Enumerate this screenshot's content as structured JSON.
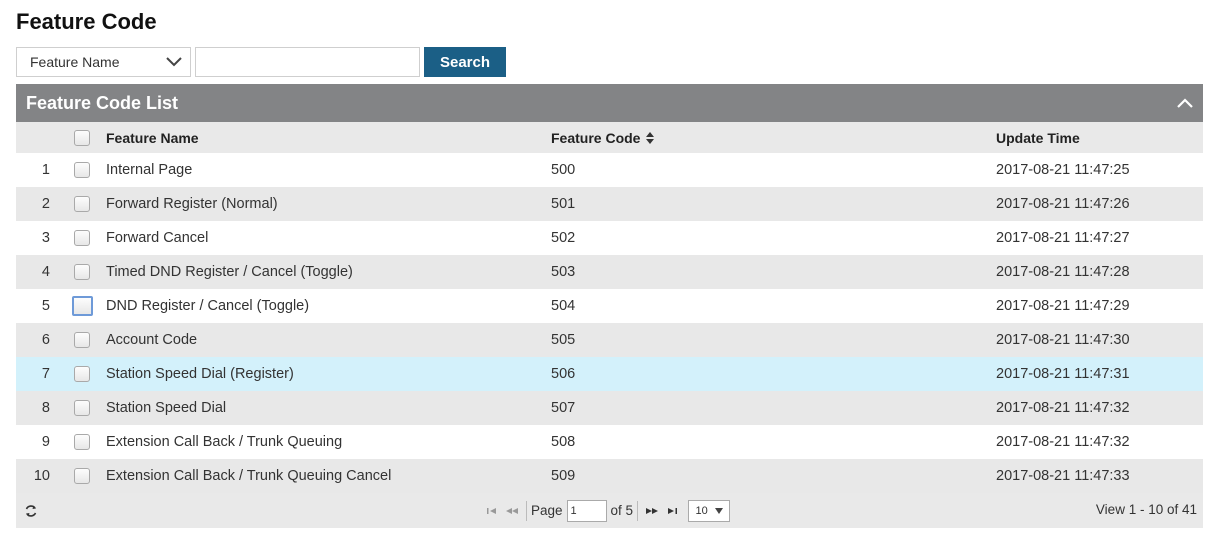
{
  "page": {
    "title": "Feature Code"
  },
  "search": {
    "field_select": "Feature Name",
    "input_value": "",
    "button_label": "Search"
  },
  "panel": {
    "title": "Feature Code List",
    "columns": {
      "name": "Feature Name",
      "code": "Feature Code",
      "time": "Update Time"
    }
  },
  "rows": [
    {
      "num": "1",
      "name": "Internal Page",
      "code": "500",
      "time": "2017-08-21 11:47:25"
    },
    {
      "num": "2",
      "name": "Forward Register (Normal)",
      "code": "501",
      "time": "2017-08-21 11:47:26"
    },
    {
      "num": "3",
      "name": "Forward Cancel",
      "code": "502",
      "time": "2017-08-21 11:47:27"
    },
    {
      "num": "4",
      "name": "Timed DND Register / Cancel (Toggle)",
      "code": "503",
      "time": "2017-08-21 11:47:28"
    },
    {
      "num": "5",
      "name": "DND Register / Cancel (Toggle)",
      "code": "504",
      "time": "2017-08-21 11:47:29"
    },
    {
      "num": "6",
      "name": "Account Code",
      "code": "505",
      "time": "2017-08-21 11:47:30"
    },
    {
      "num": "7",
      "name": "Station Speed Dial (Register)",
      "code": "506",
      "time": "2017-08-21 11:47:31"
    },
    {
      "num": "8",
      "name": "Station Speed Dial",
      "code": "507",
      "time": "2017-08-21 11:47:32"
    },
    {
      "num": "9",
      "name": "Extension Call Back / Trunk Queuing",
      "code": "508",
      "time": "2017-08-21 11:47:32"
    },
    {
      "num": "10",
      "name": "Extension Call Back / Trunk Queuing Cancel",
      "code": "509",
      "time": "2017-08-21 11:47:33"
    }
  ],
  "pager": {
    "page_label": "Page",
    "page_value": "1",
    "of_label": "of 5",
    "rows_per_page": "10",
    "view_info": "View 1 - 10 of 41"
  },
  "colors": {
    "header_bg": "#838486",
    "search_button": "#1b5f86",
    "row_highlight": "#d3f1fb",
    "row_stripe": "#e8e8e8"
  }
}
